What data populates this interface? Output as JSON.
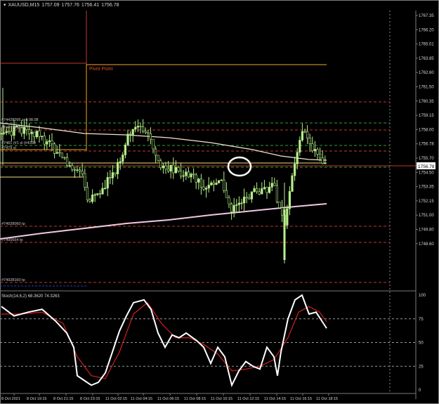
{
  "chart_title": {
    "symbol": "XAUUSD,M15",
    "ohlc": [
      "1757.09",
      "1757.76",
      "1756.41",
      "1756.78"
    ]
  },
  "price_axis": {
    "labels": [
      "1767.35",
      "1766.20",
      "1765.01",
      "1763.85",
      "1762.60",
      "1761.50",
      "1760.35",
      "1759.15",
      "1758.00",
      "1756.78",
      "1755.70",
      "1754.50",
      "1753.35",
      "1752.15",
      "1751.00",
      "1749.80",
      "1748.60"
    ],
    "current_price": "1756.78"
  },
  "pivot_label": "Pivot Point",
  "order_labels": [
    "#74428095 sell 08.08",
    "#74493982 sl",
    "#7481 (#1 sl (#4393",
    "#7479 sl",
    "#74928060 tp",
    "#7490664 tp",
    "#74928160 tp"
  ],
  "stochastic": {
    "header": "Stoch(14,6,2) 68.3620 74.3263",
    "levels": [
      "100",
      "75",
      "50",
      "25",
      "0"
    ]
  },
  "time_axis": [
    "8 Oct 2021",
    "8 Oct 19:15",
    "8 Oct 21:15",
    "8 Oct 23:15",
    "11 Oct 02:15",
    "11 Oct 04:15",
    "11 Oct 06:15",
    "11 Oct 08:15",
    "11 Oct 10:15",
    "11 Oct 12:15",
    "11 Oct 14:15",
    "11 Oct 16:15",
    "11 Oct 18:15"
  ],
  "colors": {
    "background": "#000000",
    "bull_candle": "#b6f08a",
    "pivot": "#f5a623",
    "order_green": "#3a9a3a",
    "order_red": "#c0392b",
    "ma_pink": "#f0c8e0",
    "stoch_main": "#ffffff",
    "stoch_signal": "#d02020",
    "circle": "#ffffff"
  }
}
